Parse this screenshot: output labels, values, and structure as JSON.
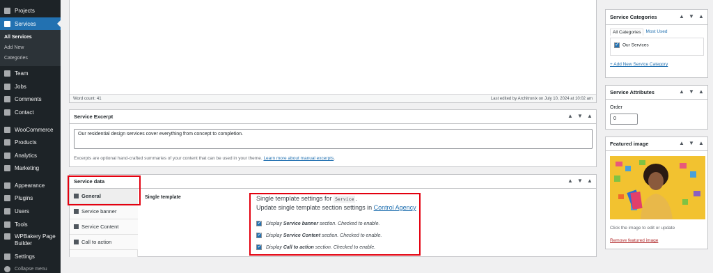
{
  "sidebar": {
    "items": [
      {
        "label": "Projects"
      },
      {
        "label": "Services"
      },
      {
        "label": "Team"
      },
      {
        "label": "Jobs"
      },
      {
        "label": "Comments"
      },
      {
        "label": "Contact"
      },
      {
        "label": "WooCommerce"
      },
      {
        "label": "Products"
      },
      {
        "label": "Analytics"
      },
      {
        "label": "Marketing"
      },
      {
        "label": "Appearance"
      },
      {
        "label": "Plugins"
      },
      {
        "label": "Users"
      },
      {
        "label": "Tools"
      },
      {
        "label": "WPBakery Page Builder"
      },
      {
        "label": "Settings"
      },
      {
        "label": "Collapse menu"
      }
    ],
    "submenu": [
      {
        "label": "All Services"
      },
      {
        "label": "Add New"
      },
      {
        "label": "Categories"
      }
    ]
  },
  "editor": {
    "word_count": "Word count: 41",
    "last_edited": "Last edited by Architronix on July 10, 2024 at 10:02 am"
  },
  "excerpt": {
    "title": "Service Excerpt",
    "text": "Our residential design services cover everything from concept to completion.",
    "help": "Excerpts are optional hand-crafted summaries of your content that can be used in your theme.",
    "help_link": "Learn more about manual excerpts"
  },
  "service_data": {
    "title": "Service data",
    "tabs": [
      {
        "label": "General"
      },
      {
        "label": "Service banner"
      },
      {
        "label": "Service Content"
      },
      {
        "label": "Call to action"
      }
    ],
    "field_label": "Single template",
    "settings_for": "Single template settings for",
    "settings_code": "Service",
    "update_text": "Update single template section settings in",
    "update_link": "Control Agency",
    "options": [
      {
        "prefix": "Display",
        "strong": "Service banner",
        "suffix": "section. Checked to enable."
      },
      {
        "prefix": "Display",
        "strong": "Service Content",
        "suffix": "section. Checked to enable."
      },
      {
        "prefix": "Display",
        "strong": "Call to action",
        "suffix": "section. Checked to enable."
      }
    ]
  },
  "categories": {
    "title": "Service Categories",
    "tab_all": "All Categories",
    "tab_used": "Most Used",
    "items": [
      {
        "label": "Our Services"
      }
    ],
    "add_new": "+ Add New Service Category"
  },
  "attributes": {
    "title": "Service Attributes",
    "order_label": "Order",
    "order_value": "0"
  },
  "featured": {
    "title": "Featured image",
    "hint": "Click the image to edit or update",
    "remove": "Remove featured image"
  },
  "icons": {
    "up": "▲",
    "down": "▼",
    "toggle": "▲"
  },
  "colors": {
    "accent": "#2271b1",
    "sidebar": "#1d2327",
    "highlight": "#e3000f"
  }
}
